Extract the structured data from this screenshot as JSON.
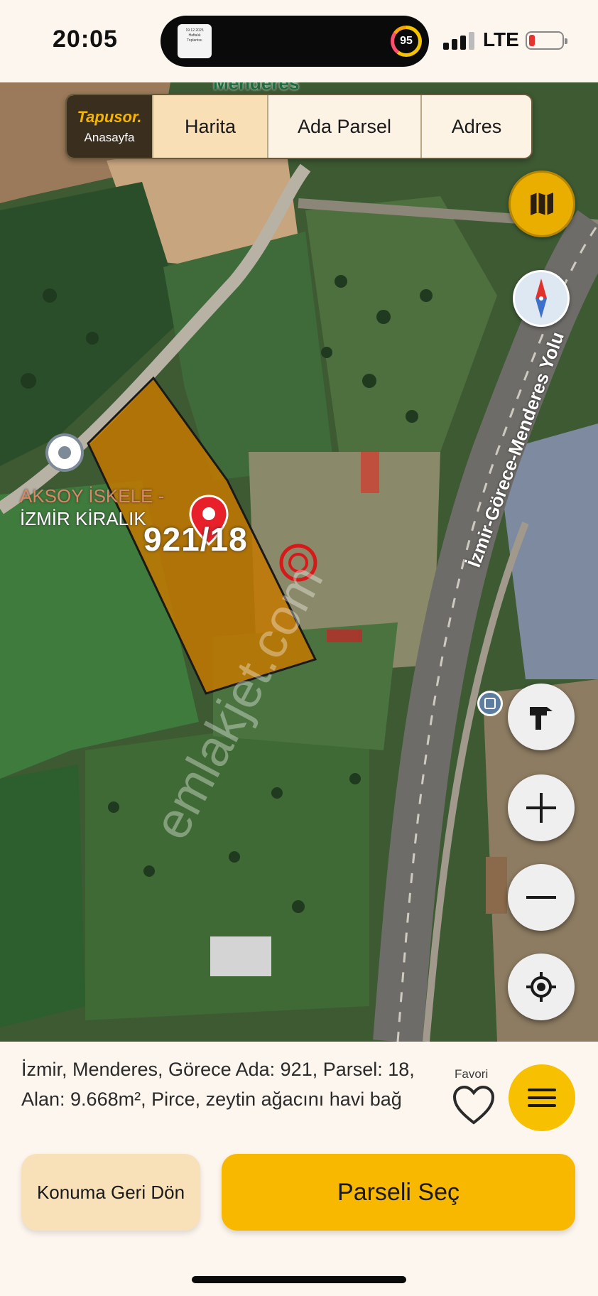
{
  "status_bar": {
    "time": "20:05",
    "island_thumb_lines": [
      "19.12.2025",
      "Haftalık",
      "Toplantısı"
    ],
    "activity_value": "95",
    "network": "LTE"
  },
  "nav": {
    "brand": "Tapusor.",
    "brand_sub": "Anasayfa",
    "tabs": [
      {
        "label": "Harita",
        "active": true
      },
      {
        "label": "Ada Parsel",
        "active": false
      },
      {
        "label": "Adres",
        "active": false
      }
    ]
  },
  "map": {
    "place_label_line1": "AKSOY İSKELE -",
    "place_label_line2": "İZMİR KİRALIK",
    "parcel_label": "921/18",
    "road_label": "İzmir-Görece-Menderes Yolu",
    "road_label_top": "Menderes",
    "watermark": "emlakjet.com",
    "parcel_color": "#c47800"
  },
  "parcel": {
    "info": "İzmir, Menderes, Görece Ada: 921, Parsel: 18, Alan: 9.668m², Pirce, zeytin ağacını havi bağ"
  },
  "actions": {
    "favorite_label": "Favori",
    "back_label": "Konuma Geri Dön",
    "select_label": "Parseli Seç"
  },
  "icons": {
    "layers": "map-icon",
    "compass": "compass-icon",
    "tool": "hammer-icon",
    "zoom_in": "plus-icon",
    "zoom_out": "minus-icon",
    "locate": "crosshair-icon",
    "favorite": "heart-icon",
    "menu": "hamburger-icon"
  },
  "colors": {
    "accent": "#f7c000",
    "accent_light": "#f8e0b8",
    "background": "#fdf6ee"
  }
}
